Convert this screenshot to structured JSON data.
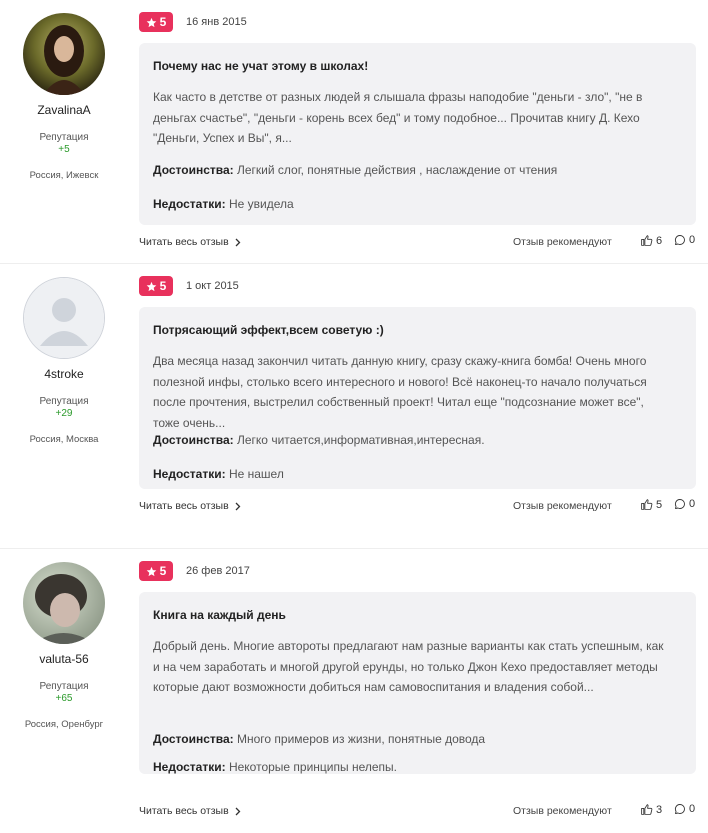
{
  "colors": {
    "rating_badge": "#e8315c",
    "reputation": "#2b9a2b",
    "card_bg": "#f2f2f4"
  },
  "reviews": [
    {
      "author": {
        "name": "ZavalinaA",
        "rep_label": "Репутация",
        "rep_value": "+5",
        "location": "Россия, Ижевск"
      },
      "rating": "5",
      "date": "16 янв 2015",
      "title": "Почему нас не учат этому в школах!",
      "text": "Как часто в детстве от разных людей я слышала фразы наподобие \"деньги - зло\", \"не в деньгах счастье\", \"деньги - корень всех бед\" и тому подобное... Прочитав книгу Д. Кехо \"Деньги, Успех и Вы\", я...",
      "pros_label": "Достоинства:",
      "pros": "Легкий слог, понятные действия , наслаждение от чтения",
      "cons_label": "Недостатки:",
      "cons": "Не увидела",
      "read_more": "Читать весь отзыв",
      "recommend": "Отзыв рекомендуют",
      "likes": "6",
      "comments": "0"
    },
    {
      "author": {
        "name": "4stroke",
        "rep_label": "Репутация",
        "rep_value": "+29",
        "location": "Россия, Москва"
      },
      "rating": "5",
      "date": "1 окт 2015",
      "title": "Потрясающий эффект,всем советую :)",
      "text": "Два месяца назад закончил читать данную книгу, сразу скажу-книга бомба! Очень много полезной инфы, столько всего интересного и нового! Всё наконец-то начало получаться после прочтения, выстрелил собственный проект! Читал еще \"подсознание может все\", тоже очень...",
      "pros_label": "Достоинства:",
      "pros": "Легко читается,информативная,интересная.",
      "cons_label": "Недостатки:",
      "cons": "Не нашел",
      "read_more": "Читать весь отзыв",
      "recommend": "Отзыв рекомендуют",
      "likes": "5",
      "comments": "0"
    },
    {
      "author": {
        "name": "valuta-56",
        "rep_label": "Репутация",
        "rep_value": "+65",
        "location": "Россия, Оренбург"
      },
      "rating": "5",
      "date": "26 фев 2017",
      "title": "Книга на каждый день",
      "text": "Добрый день. Многие автороты предлагают нам разные варианты как стать успешным, как и на чем заработать и многой другой ерунды, но только Джон Кехо предоставляет методы которые дают возможности добиться нам самовоспитания и владения собой...",
      "pros_label": "Достоинства:",
      "pros": "Много примеров из жизни, понятные довода",
      "cons_label": "Недостатки:",
      "cons": "Некоторые принципы нелепы.",
      "read_more": "Читать весь отзыв",
      "recommend": "Отзыв рекомендуют",
      "likes": "3",
      "comments": "0"
    }
  ]
}
